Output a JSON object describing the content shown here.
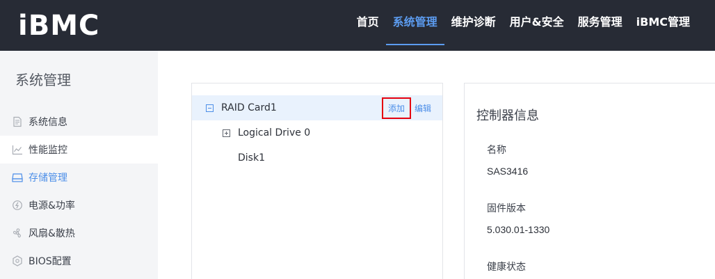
{
  "header": {
    "logo": "iBMC",
    "nav": [
      {
        "label": "首页",
        "active": false
      },
      {
        "label": "系统管理",
        "active": true
      },
      {
        "label": "维护诊断",
        "active": false
      },
      {
        "label": "用户&安全",
        "active": false
      },
      {
        "label": "服务管理",
        "active": false
      },
      {
        "label": "iBMC管理",
        "active": false
      }
    ]
  },
  "sidebar": {
    "title": "系统管理",
    "items": [
      {
        "label": "系统信息",
        "icon": "document-icon"
      },
      {
        "label": "性能监控",
        "icon": "line-chart-icon"
      },
      {
        "label": "存储管理",
        "icon": "storage-icon",
        "active": true
      },
      {
        "label": "电源&功率",
        "icon": "power-icon"
      },
      {
        "label": "风扇&散热",
        "icon": "fan-icon"
      },
      {
        "label": "BIOS配置",
        "icon": "bios-icon"
      }
    ]
  },
  "tree": {
    "root": {
      "label": "RAID Card1",
      "add": "添加",
      "edit": "编辑"
    },
    "children": [
      {
        "label": "Logical Drive 0"
      },
      {
        "label": "Disk1"
      }
    ]
  },
  "info": {
    "title": "控制器信息",
    "fields": [
      {
        "label": "名称",
        "value": "SAS3416"
      },
      {
        "label": "固件版本",
        "value": "5.030.01-1330"
      },
      {
        "label": "健康状态",
        "value": ""
      }
    ]
  },
  "colors": {
    "header_bg": "#272b35",
    "accent": "#4c8ee8",
    "highlight_border": "#e5000f",
    "sidebar_bg": "#f4f5f7"
  }
}
